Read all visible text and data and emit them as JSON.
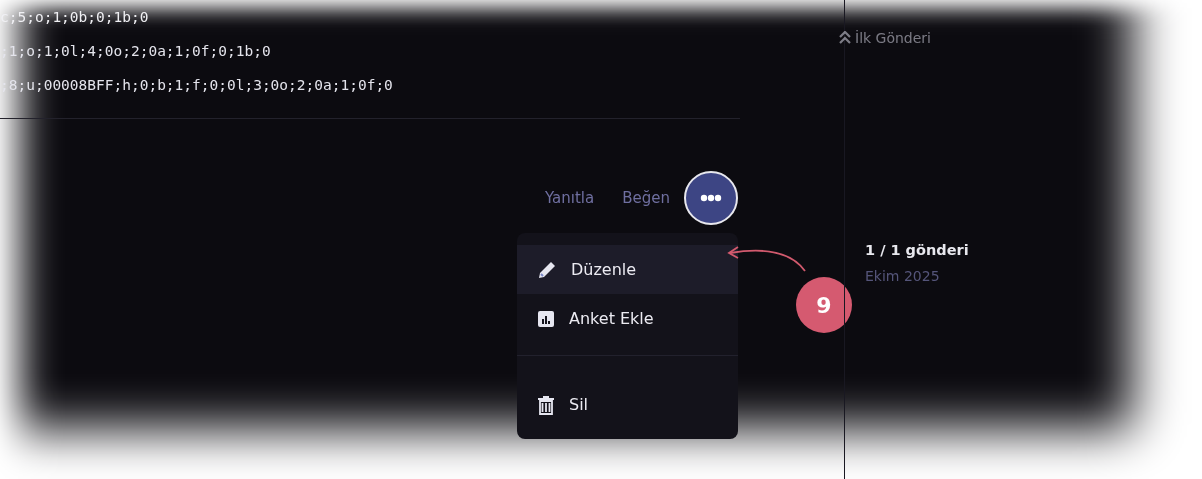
{
  "code_lines": [
    "c;5;o;1;0b;0;1b;0",
    ";1;o;1;0l;4;0o;2;0a;1;0f;0;1b;0",
    ";8;u;00008BFF;h;0;b;1;f;0;0l;3;0o;2;0a;1;0f;0"
  ],
  "actions": [
    {
      "label": "Yanıtla"
    },
    {
      "label": "Beğen"
    }
  ],
  "more_button": {
    "expanded": true
  },
  "menu": [
    {
      "kind": "edit",
      "label": "Düzenle",
      "selected": true
    },
    {
      "kind": "poll",
      "label": "Anket Ekle",
      "selected": false
    },
    {
      "kind": "delete",
      "label": "Sil",
      "selected": false
    }
  ],
  "sidebar": {
    "first_post": "İlk Gönderi",
    "count": "1 / 1 gönderi",
    "date": "Ekim 2025"
  },
  "annotation": {
    "label": "9"
  }
}
